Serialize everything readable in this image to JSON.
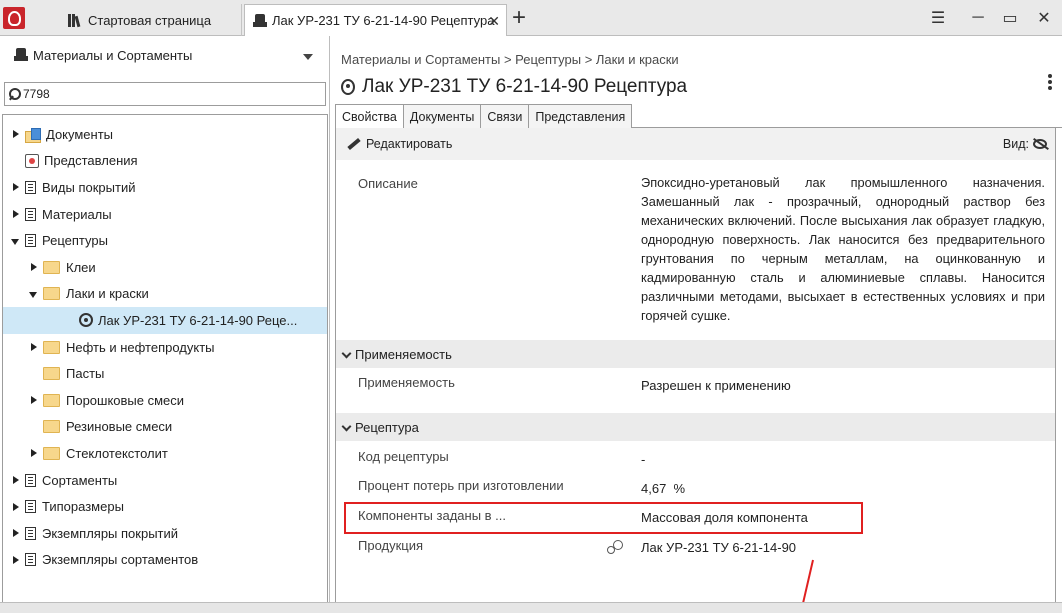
{
  "window": {
    "tabs": [
      {
        "label": "Стартовая страница"
      },
      {
        "label": "Лак УР-231 ТУ 6-21-14-90 Рецептура"
      }
    ]
  },
  "left_panel": {
    "header": "Материалы и Сортаменты",
    "search_value": "7798",
    "tree": [
      {
        "label": "Документы",
        "level": 0,
        "expand": "right",
        "icon": "documents-folder-icon"
      },
      {
        "label": "Представления",
        "level": 0,
        "expand": "none",
        "icon": "views-icon"
      },
      {
        "label": "Виды покрытий",
        "level": 0,
        "expand": "right",
        "icon": "document-icon"
      },
      {
        "label": "Материалы",
        "level": 0,
        "expand": "right",
        "icon": "document-icon"
      },
      {
        "label": "Рецептуры",
        "level": 0,
        "expand": "down",
        "icon": "document-icon"
      },
      {
        "label": "Клеи",
        "level": 1,
        "expand": "right",
        "icon": "folder-icon"
      },
      {
        "label": "Лаки и краски",
        "level": 1,
        "expand": "down",
        "icon": "folder-icon"
      },
      {
        "label": "Лак УР-231 ТУ 6-21-14-90 Реце...",
        "level": 2,
        "expand": "none",
        "icon": "recipe-icon",
        "selected": true
      },
      {
        "label": "Нефть и нефтепродукты",
        "level": 1,
        "expand": "right",
        "icon": "folder-icon"
      },
      {
        "label": "Пасты",
        "level": 1,
        "expand": "none",
        "icon": "folder-icon"
      },
      {
        "label": "Порошковые смеси",
        "level": 1,
        "expand": "right",
        "icon": "folder-icon"
      },
      {
        "label": "Резиновые смеси",
        "level": 1,
        "expand": "none",
        "icon": "folder-icon"
      },
      {
        "label": "Стеклотекстолит",
        "level": 1,
        "expand": "right",
        "icon": "folder-icon"
      },
      {
        "label": "Сортаменты",
        "level": 0,
        "expand": "right",
        "icon": "document-icon"
      },
      {
        "label": "Типоразмеры",
        "level": 0,
        "expand": "right",
        "icon": "document-icon"
      },
      {
        "label": "Экземпляры покрытий",
        "level": 0,
        "expand": "right",
        "icon": "document-icon"
      },
      {
        "label": "Экземпляры сортаментов",
        "level": 0,
        "expand": "right",
        "icon": "document-icon"
      }
    ]
  },
  "main": {
    "breadcrumb": "Материалы и Сортаменты > Рецептуры > Лаки и краски",
    "title": "Лак УР-231 ТУ 6-21-14-90 Рецептура",
    "tabs": [
      "Свойства",
      "Документы",
      "Связи",
      "Представления"
    ],
    "toolbar": {
      "edit_label": "Редактировать",
      "view_label": "Вид:"
    },
    "description": {
      "label": "Описание",
      "value": "Эпоксидно-уретановый лак промышленного назначения. Замешанный лак - прозрачный, однородный раствор без механических включений. После высыхания лак образует гладкую, однородную поверхность. Лак наносится без предварительного грунтования по черным металлам, на оцинкованную и кадмированную сталь и алюминиевые сплавы. Наносится различными методами, высыхает в естественных условиях и при горячей сушке."
    },
    "section_applicability": {
      "title": "Применяемость",
      "label": "Применяемость",
      "value": "Разрешен к применению"
    },
    "section_recipe": {
      "title": "Рецептура",
      "rows": [
        {
          "label": "Код рецептуры",
          "value": "-"
        },
        {
          "label": "Процент потерь при изготовлении",
          "value": "4,67  %"
        },
        {
          "label": "Компоненты заданы в ...",
          "value": "Массовая доля компонента"
        },
        {
          "label": "Продукция",
          "value": "Лак УР-231 ТУ 6-21-14-90"
        }
      ]
    }
  }
}
